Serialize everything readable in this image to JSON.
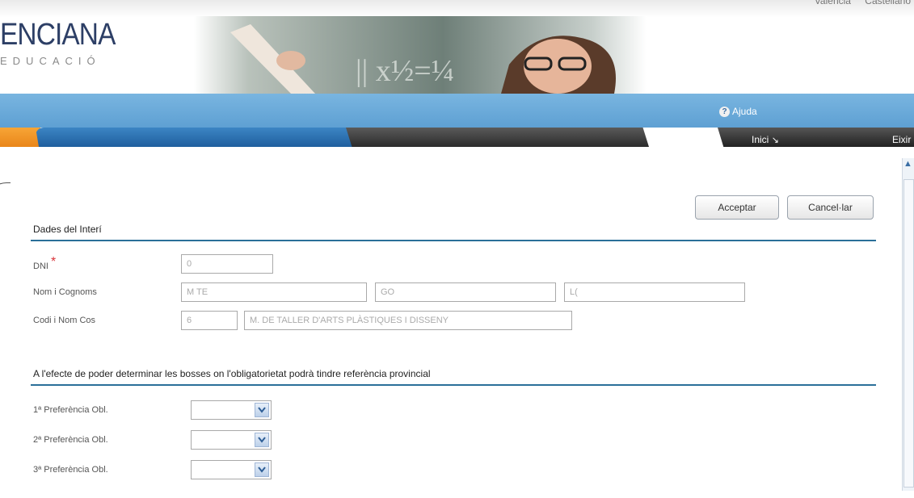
{
  "header": {
    "brand_main": "ENCIANA",
    "brand_sub": "EDUCACIÓ",
    "top_links": [
      "Valencià",
      "Castellano"
    ],
    "help_label": "Ajuda"
  },
  "nav": {
    "inici_label": "Inici",
    "eixir_label": "Eixir"
  },
  "actions": {
    "accept_label": "Acceptar",
    "cancel_label": "Cancel·lar"
  },
  "section1": {
    "title": "Dades del Interí",
    "dni_label": "DNI",
    "dni_value": "0",
    "name_label": "Nom i Cognoms",
    "name_value": "M TE",
    "surname1_value": "GO",
    "surname2_value": "L(",
    "code_label": "Codi i Nom Cos",
    "code_value": "6",
    "cos_name_value": "M. DE TALLER D'ARTS PLÀSTIQUES I DISSENY"
  },
  "section2": {
    "title": "A l'efecte de poder determinar les bosses on l'obligatorietat podrà tindre referència provincial",
    "preferences": [
      {
        "label": "1ª Preferència Obl.",
        "value": ""
      },
      {
        "label": "2ª Preferència Obl.",
        "value": ""
      },
      {
        "label": "3ª Preferència Obl.",
        "value": ""
      }
    ]
  },
  "colors": {
    "blue_bar": "#6aa9da",
    "accent_line": "#2a6f99",
    "orange_tab": "#f29a2e",
    "required": "#d9343a"
  }
}
